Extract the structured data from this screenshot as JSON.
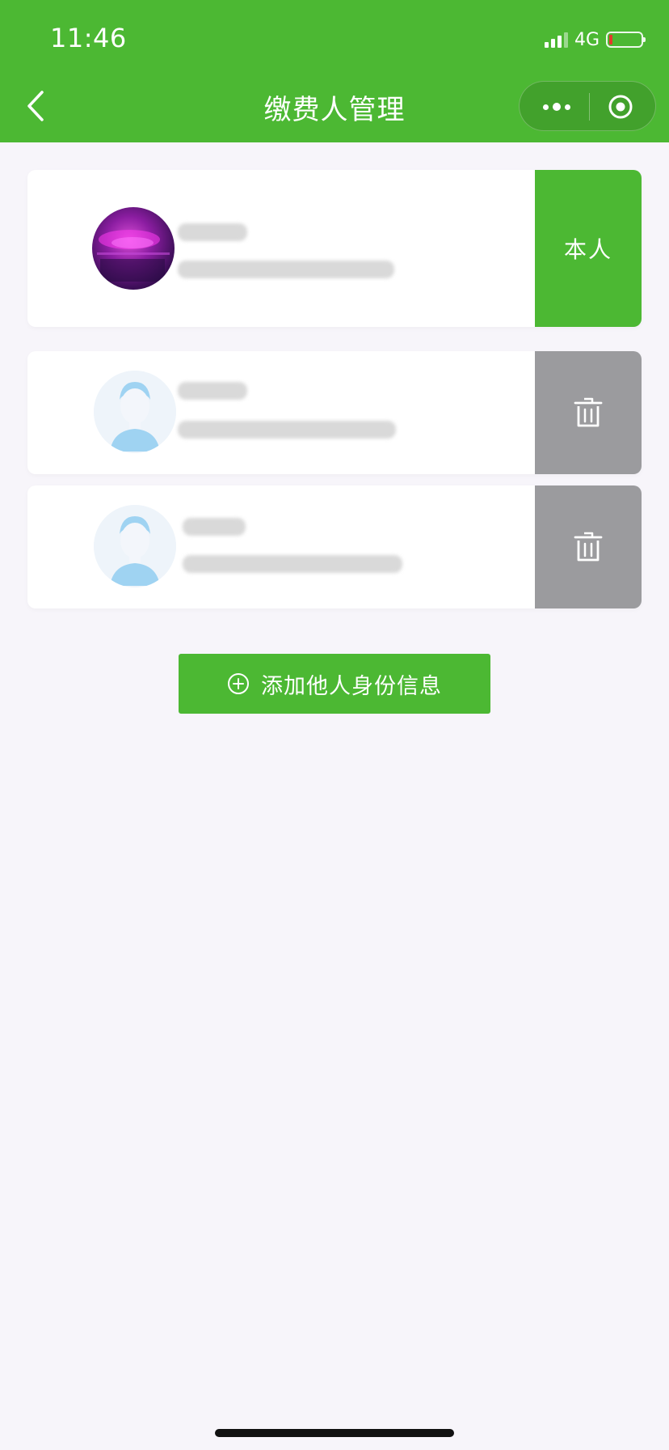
{
  "status_bar": {
    "time": "11:46",
    "network": "4G"
  },
  "nav": {
    "title": "缴费人管理"
  },
  "cards": [
    {
      "action_label": "本人"
    },
    {},
    {}
  ],
  "add_button": {
    "label": "添加他人身份信息"
  },
  "colors": {
    "brand_green": "#4cb833",
    "delete_gray": "#9b9b9e",
    "background": "#f7f5fa"
  },
  "icons": [
    "back-chevron-icon",
    "more-dots-icon",
    "close-circle-icon",
    "trash-icon",
    "plus-circle-icon",
    "default-avatar-icon"
  ]
}
